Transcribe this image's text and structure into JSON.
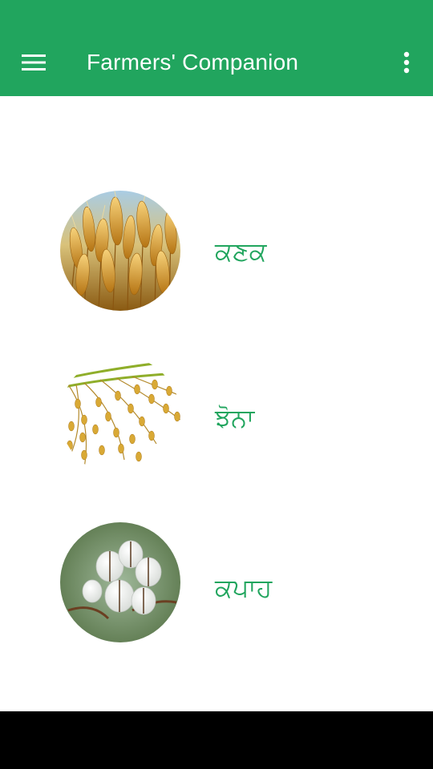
{
  "app_bar": {
    "title": "Farmers' Companion",
    "color": "#21a55e",
    "menu_icon": "hamburger-menu-icon",
    "overflow_icon": "more-vertical-icon"
  },
  "crops": [
    {
      "label": "ਕਣਕ",
      "image": "wheat-image"
    },
    {
      "label": "ਝੋਨਾ",
      "image": "paddy-image"
    },
    {
      "label": "ਕਪਾਹ",
      "image": "cotton-image"
    }
  ]
}
